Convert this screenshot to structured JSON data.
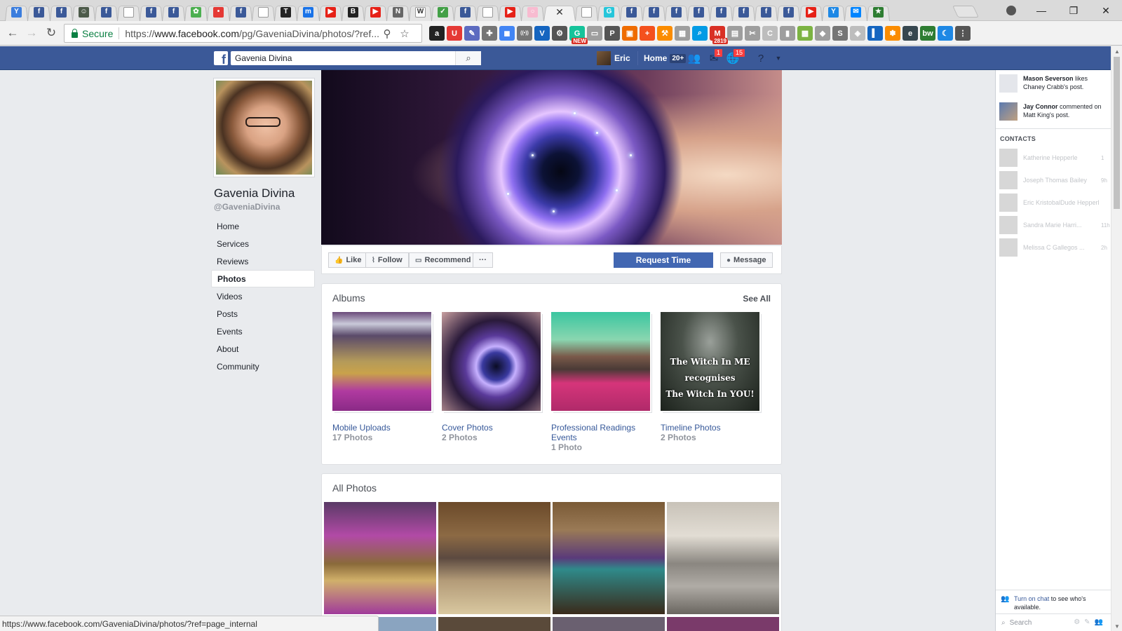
{
  "browser": {
    "tabs": [
      {
        "icon": "yelp-icon",
        "color": "#3b7ddd",
        "glyph": "Y"
      },
      {
        "icon": "facebook-icon",
        "color": "#3b5998",
        "glyph": "f"
      },
      {
        "icon": "facebook-icon",
        "color": "#3b5998",
        "glyph": "f"
      },
      {
        "icon": "avatar-icon",
        "color": "#4d5b4a",
        "glyph": "☺"
      },
      {
        "icon": "facebook-icon",
        "color": "#3b5998",
        "glyph": "f"
      },
      {
        "icon": "document-icon",
        "color": "#9e9e9e",
        "glyph": ""
      },
      {
        "icon": "facebook-icon",
        "color": "#3b5998",
        "glyph": "f"
      },
      {
        "icon": "facebook-icon",
        "color": "#3b5998",
        "glyph": "f"
      },
      {
        "icon": "gear-green-icon",
        "color": "#4caf50",
        "glyph": "✿"
      },
      {
        "icon": "pinterest-dot-icon",
        "color": "#e53935",
        "glyph": "•"
      },
      {
        "icon": "facebook-icon",
        "color": "#3b5998",
        "glyph": "f"
      },
      {
        "icon": "document-icon",
        "color": "#9e9e9e",
        "glyph": ""
      },
      {
        "icon": "nytimes-icon",
        "color": "#222222",
        "glyph": "T"
      },
      {
        "icon": "m-icon",
        "color": "#1a73e8",
        "glyph": "m"
      },
      {
        "icon": "youtube-icon",
        "color": "#e62117",
        "glyph": "▶"
      },
      {
        "icon": "bbc-icon",
        "color": "#222222",
        "glyph": "B"
      },
      {
        "icon": "youtube-icon",
        "color": "#e62117",
        "glyph": "▶"
      },
      {
        "icon": "news-icon",
        "color": "#666666",
        "glyph": "N"
      },
      {
        "icon": "wikipedia-icon",
        "color": "#ffffff",
        "glyph": "W"
      },
      {
        "icon": "shield-icon",
        "color": "#43a047",
        "glyph": "✓"
      },
      {
        "icon": "facebook-icon",
        "color": "#3b5998",
        "glyph": "f"
      },
      {
        "icon": "document-icon",
        "color": "#9e9e9e",
        "glyph": ""
      },
      {
        "icon": "youtube-icon",
        "color": "#e62117",
        "glyph": "▶"
      },
      {
        "icon": "loading-icon",
        "color": "#f8bbd0",
        "glyph": "○"
      },
      {
        "icon": "close-icon",
        "color": "",
        "glyph": "✕",
        "active": true
      },
      {
        "icon": "document-icon",
        "color": "#9e9e9e",
        "glyph": ""
      },
      {
        "icon": "g-icon",
        "color": "#26c6da",
        "glyph": "G"
      },
      {
        "icon": "facebook-icon",
        "color": "#3b5998",
        "glyph": "f"
      },
      {
        "icon": "facebook-icon",
        "color": "#3b5998",
        "glyph": "f"
      },
      {
        "icon": "facebook-icon",
        "color": "#3b5998",
        "glyph": "f"
      },
      {
        "icon": "facebook-icon",
        "color": "#3b5998",
        "glyph": "f"
      },
      {
        "icon": "facebook-icon",
        "color": "#3b5998",
        "glyph": "f"
      },
      {
        "icon": "facebook-icon",
        "color": "#3b5998",
        "glyph": "f"
      },
      {
        "icon": "facebook-icon",
        "color": "#3b5998",
        "glyph": "f"
      },
      {
        "icon": "facebook-icon",
        "color": "#3b5998",
        "glyph": "f"
      },
      {
        "icon": "youtube-icon",
        "color": "#e62117",
        "glyph": "▶"
      },
      {
        "icon": "y-icon",
        "color": "#1e88e5",
        "glyph": "Y"
      },
      {
        "icon": "messenger-icon",
        "color": "#0084ff",
        "glyph": "✉"
      },
      {
        "icon": "star-icon",
        "color": "#2e7d32",
        "glyph": "★"
      }
    ],
    "window_controls": {
      "minimize": "—",
      "restore": "❐",
      "close": "✕"
    },
    "security_label": "Secure",
    "url_prefix": "https://",
    "url_host": "www.facebook.com",
    "url_path": "/pg/GaveniaDivina/photos/?ref...",
    "extensions": [
      {
        "icon": "amazon-icon",
        "color": "#222222",
        "glyph": "a",
        "badge": ""
      },
      {
        "icon": "magnet-icon",
        "color": "#e53935",
        "glyph": "U",
        "badge": ""
      },
      {
        "icon": "eyedropper-icon",
        "color": "#5c6bc0",
        "glyph": "✎",
        "badge": ""
      },
      {
        "icon": "puzzle-icon",
        "color": "#757575",
        "glyph": "✚",
        "badge": ""
      },
      {
        "icon": "google-icon",
        "color": "#4285f4",
        "glyph": "◼",
        "badge": ""
      },
      {
        "icon": "signal-icon",
        "color": "#757575",
        "glyph": "((•))",
        "badge": ""
      },
      {
        "icon": "v-icon",
        "color": "#1565c0",
        "glyph": "V",
        "badge": ""
      },
      {
        "icon": "settings-icon",
        "color": "#555555",
        "glyph": "⚙",
        "badge": ""
      },
      {
        "icon": "grammarly-icon",
        "color": "#15c39a",
        "glyph": "G",
        "badge": "NEW"
      },
      {
        "icon": "card-icon",
        "color": "#9e9e9e",
        "glyph": "▭",
        "badge": ""
      },
      {
        "icon": "pinterest-icon",
        "color": "#555555",
        "glyph": "P",
        "badge": ""
      },
      {
        "icon": "screenshot-icon",
        "color": "#ef6c00",
        "glyph": "▣",
        "badge": ""
      },
      {
        "icon": "plus-icon",
        "color": "#f4511e",
        "glyph": "+",
        "badge": ""
      },
      {
        "icon": "hammer-icon",
        "color": "#fb8c00",
        "glyph": "⚒",
        "badge": ""
      },
      {
        "icon": "grid-icon",
        "color": "#9e9e9e",
        "glyph": "▦",
        "badge": ""
      },
      {
        "icon": "search-blue-icon",
        "color": "#039be5",
        "glyph": "⌕",
        "badge": ""
      },
      {
        "icon": "gmail-icon",
        "color": "#d93025",
        "glyph": "M",
        "badge": "2819"
      },
      {
        "icon": "window-icon",
        "color": "#9e9e9e",
        "glyph": "▤",
        "badge": ""
      },
      {
        "icon": "tools-icon",
        "color": "#9e9e9e",
        "glyph": "✂",
        "badge": ""
      },
      {
        "icon": "c-icon",
        "color": "#bdbdbd",
        "glyph": "C",
        "badge": ""
      },
      {
        "icon": "panel-icon",
        "color": "#9e9e9e",
        "glyph": "▮",
        "badge": ""
      },
      {
        "icon": "photo-icon",
        "color": "#7cb342",
        "glyph": "▩",
        "badge": ""
      },
      {
        "icon": "tag-icon",
        "color": "#9e9e9e",
        "glyph": "◆",
        "badge": ""
      },
      {
        "icon": "s-icon",
        "color": "#757575",
        "glyph": "S",
        "badge": ""
      },
      {
        "icon": "shield-gray-icon",
        "color": "#bdbdbd",
        "glyph": "◈",
        "badge": ""
      },
      {
        "icon": "bookmark-icon",
        "color": "#1565c0",
        "glyph": "▍",
        "badge": ""
      },
      {
        "icon": "flower-icon",
        "color": "#fb8c00",
        "glyph": "✽",
        "badge": ""
      },
      {
        "icon": "e-icon",
        "color": "#37474f",
        "glyph": "e",
        "badge": ""
      },
      {
        "icon": "bw-icon",
        "color": "#2e7d32",
        "glyph": "bw",
        "badge": ""
      },
      {
        "icon": "moon-icon",
        "color": "#1e88e5",
        "glyph": "☾",
        "badge": ""
      },
      {
        "icon": "menu-icon",
        "color": "#555555",
        "glyph": "⋮",
        "badge": ""
      }
    ],
    "status_url": "https://www.facebook.com/GaveniaDivina/photos/?ref=page_internal"
  },
  "fb_bar": {
    "search_value": "Gavenia Divina",
    "user_name": "Eric",
    "home_label": "Home",
    "home_count": "20+",
    "messages_badge": "1",
    "notifications_badge": "15"
  },
  "page": {
    "name": "Gavenia Divina",
    "handle": "@GaveniaDivina",
    "nav": [
      "Home",
      "Services",
      "Reviews",
      "Photos",
      "Videos",
      "Posts",
      "Events",
      "About",
      "Community"
    ],
    "active_nav": "Photos"
  },
  "actions": {
    "like": "Like",
    "follow": "Follow",
    "recommend": "Recommend",
    "more": "···",
    "request": "Request Time",
    "message": "Message"
  },
  "albums": {
    "title": "Albums",
    "see_all": "See All",
    "items": [
      {
        "title": "Mobile Uploads",
        "count": "17 Photos",
        "cover": "mobile"
      },
      {
        "title": "Cover Photos",
        "count": "2 Photos",
        "cover": "eye"
      },
      {
        "title": "Professional Readings Events",
        "count": "1 Photo",
        "cover": "table"
      },
      {
        "title": "Timeline Photos",
        "count": "2 Photos",
        "cover": "witch"
      }
    ],
    "witch_lines": [
      "The Witch In ME",
      "recognises",
      "The Witch In YOU!"
    ]
  },
  "all_photos": {
    "title": "All Photos"
  },
  "ticker": [
    {
      "actor": "Mason Severson",
      "text": " likes Chaney Crabb's post."
    },
    {
      "actor": "Jay Connor",
      "text": " commented on Matt King's post."
    }
  ],
  "contacts": {
    "heading": "CONTACTS",
    "items": [
      {
        "name": "Katherine Hepperle",
        "time": "1"
      },
      {
        "name": "Joseph Thomas Bailey",
        "time": "9h"
      },
      {
        "name": "Eric KristobalDude Hepperle",
        "time": ""
      },
      {
        "name": "Sandra Marie Harri...",
        "time": "11h"
      },
      {
        "name": "Melissa C Gallegos ...",
        "time": "2h"
      }
    ]
  },
  "chat": {
    "link": "Turn on chat",
    "rest": " to see who's available.",
    "search_placeholder": "Search"
  }
}
